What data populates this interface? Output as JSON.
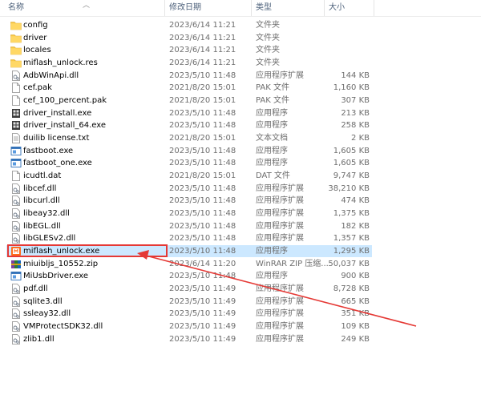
{
  "columns": {
    "name": "名称",
    "date": "修改日期",
    "type": "类型",
    "size": "大小"
  },
  "files": [
    {
      "name": "config",
      "date": "2023/6/14 11:21",
      "type": "文件夹",
      "size": "",
      "icon": "folder-icon"
    },
    {
      "name": "driver",
      "date": "2023/6/14 11:21",
      "type": "文件夹",
      "size": "",
      "icon": "folder-icon"
    },
    {
      "name": "locales",
      "date": "2023/6/14 11:21",
      "type": "文件夹",
      "size": "",
      "icon": "folder-icon"
    },
    {
      "name": "miflash_unlock.res",
      "date": "2023/6/14 11:21",
      "type": "文件夹",
      "size": "",
      "icon": "folder-icon"
    },
    {
      "name": "AdbWinApi.dll",
      "date": "2023/5/10 11:48",
      "type": "应用程序扩展",
      "size": "144 KB",
      "icon": "dll-icon"
    },
    {
      "name": "cef.pak",
      "date": "2021/8/20 15:01",
      "type": "PAK 文件",
      "size": "1,160 KB",
      "icon": "file-icon"
    },
    {
      "name": "cef_100_percent.pak",
      "date": "2021/8/20 15:01",
      "type": "PAK 文件",
      "size": "307 KB",
      "icon": "file-icon"
    },
    {
      "name": "driver_install.exe",
      "date": "2023/5/10 11:48",
      "type": "应用程序",
      "size": "213 KB",
      "icon": "installer-icon"
    },
    {
      "name": "driver_install_64.exe",
      "date": "2023/5/10 11:48",
      "type": "应用程序",
      "size": "258 KB",
      "icon": "installer-icon"
    },
    {
      "name": "duilib license.txt",
      "date": "2021/8/20 15:01",
      "type": "文本文档",
      "size": "2 KB",
      "icon": "text-file-icon"
    },
    {
      "name": "fastboot.exe",
      "date": "2023/5/10 11:48",
      "type": "应用程序",
      "size": "1,605 KB",
      "icon": "exe-icon"
    },
    {
      "name": "fastboot_one.exe",
      "date": "2023/5/10 11:48",
      "type": "应用程序",
      "size": "1,605 KB",
      "icon": "exe-icon"
    },
    {
      "name": "icudtl.dat",
      "date": "2021/8/20 15:01",
      "type": "DAT 文件",
      "size": "9,747 KB",
      "icon": "file-icon"
    },
    {
      "name": "libcef.dll",
      "date": "2023/5/10 11:48",
      "type": "应用程序扩展",
      "size": "38,210 KB",
      "icon": "dll-icon"
    },
    {
      "name": "libcurl.dll",
      "date": "2023/5/10 11:48",
      "type": "应用程序扩展",
      "size": "474 KB",
      "icon": "dll-icon"
    },
    {
      "name": "libeay32.dll",
      "date": "2023/5/10 11:48",
      "type": "应用程序扩展",
      "size": "1,375 KB",
      "icon": "dll-icon"
    },
    {
      "name": "libEGL.dll",
      "date": "2023/5/10 11:48",
      "type": "应用程序扩展",
      "size": "182 KB",
      "icon": "dll-icon"
    },
    {
      "name": "libGLESv2.dll",
      "date": "2023/5/10 11:48",
      "type": "应用程序扩展",
      "size": "1,357 KB",
      "icon": "dll-icon"
    },
    {
      "name": "miflash_unlock.exe",
      "date": "2023/5/10 11:48",
      "type": "应用程序",
      "size": "1,295 KB",
      "icon": "app-icon",
      "selected": true
    },
    {
      "name": "miuibljs_10552.zip",
      "date": "2023/6/14 11:20",
      "type": "WinRAR ZIP 压缩...",
      "size": "50,037 KB",
      "icon": "zip-icon"
    },
    {
      "name": "MiUsbDriver.exe",
      "date": "2023/5/10 11:48",
      "type": "应用程序",
      "size": "900 KB",
      "icon": "exe-icon"
    },
    {
      "name": "pdf.dll",
      "date": "2023/5/10 11:49",
      "type": "应用程序扩展",
      "size": "8,728 KB",
      "icon": "dll-icon"
    },
    {
      "name": "sqlite3.dll",
      "date": "2023/5/10 11:49",
      "type": "应用程序扩展",
      "size": "665 KB",
      "icon": "dll-icon"
    },
    {
      "name": "ssleay32.dll",
      "date": "2023/5/10 11:49",
      "type": "应用程序扩展",
      "size": "351 KB",
      "icon": "dll-icon"
    },
    {
      "name": "VMProtectSDK32.dll",
      "date": "2023/5/10 11:49",
      "type": "应用程序扩展",
      "size": "109 KB",
      "icon": "dll-icon"
    },
    {
      "name": "zlib1.dll",
      "date": "2023/5/10 11:49",
      "type": "应用程序扩展",
      "size": "249 KB",
      "icon": "dll-icon"
    }
  ],
  "colors": {
    "selection": "#cce8ff",
    "annotation": "#e53935",
    "folder": "#f6c644"
  }
}
